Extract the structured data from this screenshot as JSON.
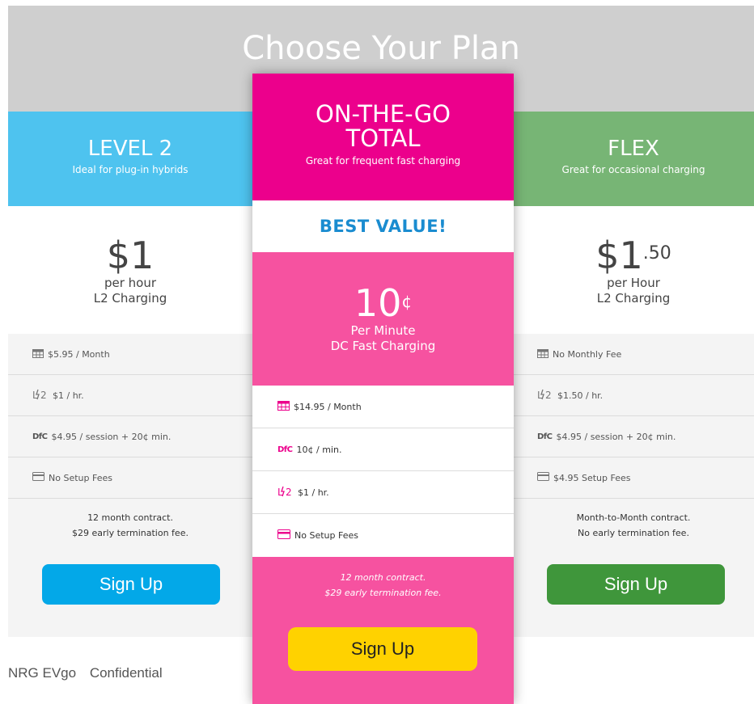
{
  "header": {
    "title": "Choose Your Plan"
  },
  "plans": {
    "left": {
      "name": "LEVEL 2",
      "subtitle": "Ideal for plug-in hybrids",
      "price": "$1",
      "price_super": "",
      "price_unit": "per hour",
      "price_desc": "L2 Charging",
      "features": [
        {
          "icon": "calendar-icon",
          "text": "$5.95 / Month"
        },
        {
          "icon": "l2-charging-icon",
          "text": "$1 / hr."
        },
        {
          "icon": "dc-fast-charging-icon",
          "icon_text": "DfC",
          "text": "$4.95 / session + 20¢ min."
        },
        {
          "icon": "credit-card-icon",
          "text": "No Setup Fees"
        }
      ],
      "contract_line1": "12 month contract.",
      "contract_line2": "$29 early termination fee.",
      "button": "Sign Up",
      "color": "#4ec3ef",
      "button_color": "#03a8e8"
    },
    "center": {
      "name_line1": "ON-THE-GO",
      "name_line2": "TOTAL",
      "subtitle": "Great for frequent fast charging",
      "badge": "BEST VALUE!",
      "price": "10",
      "price_super": "¢",
      "price_unit": "Per Minute",
      "price_desc": "DC Fast Charging",
      "features": [
        {
          "icon": "calendar-icon",
          "text": "$14.95 / Month"
        },
        {
          "icon": "dc-fast-charging-icon",
          "icon_text": "DfC",
          "text": "10¢ / min."
        },
        {
          "icon": "l2-charging-icon",
          "text": "$1 / hr."
        },
        {
          "icon": "credit-card-icon",
          "text": "No Setup Fees"
        }
      ],
      "contract_line1": "12 month contract.",
      "contract_line2": "$29 early termination fee.",
      "button": "Sign Up",
      "color": "#ec008c",
      "button_color": "#ffd200"
    },
    "right": {
      "name": "FLEX",
      "subtitle": "Great for occasional charging",
      "price": "$1",
      "price_super": ".50",
      "price_unit": "per Hour",
      "price_desc": "L2 Charging",
      "features": [
        {
          "icon": "calendar-icon",
          "text": "No Monthly Fee"
        },
        {
          "icon": "l2-charging-icon",
          "text": "$1.50 / hr."
        },
        {
          "icon": "dc-fast-charging-icon",
          "icon_text": "DfC",
          "text": "$4.95 / session + 20¢ min."
        },
        {
          "icon": "credit-card-icon",
          "text": "$4.95 Setup Fees"
        }
      ],
      "contract_line1": "Month-to-Month contract.",
      "contract_line2": "No early termination fee.",
      "button": "Sign Up",
      "color": "#77b575",
      "button_color": "#3f963b"
    }
  },
  "footer": {
    "company": "NRG EVgo",
    "label": "Confidential"
  }
}
